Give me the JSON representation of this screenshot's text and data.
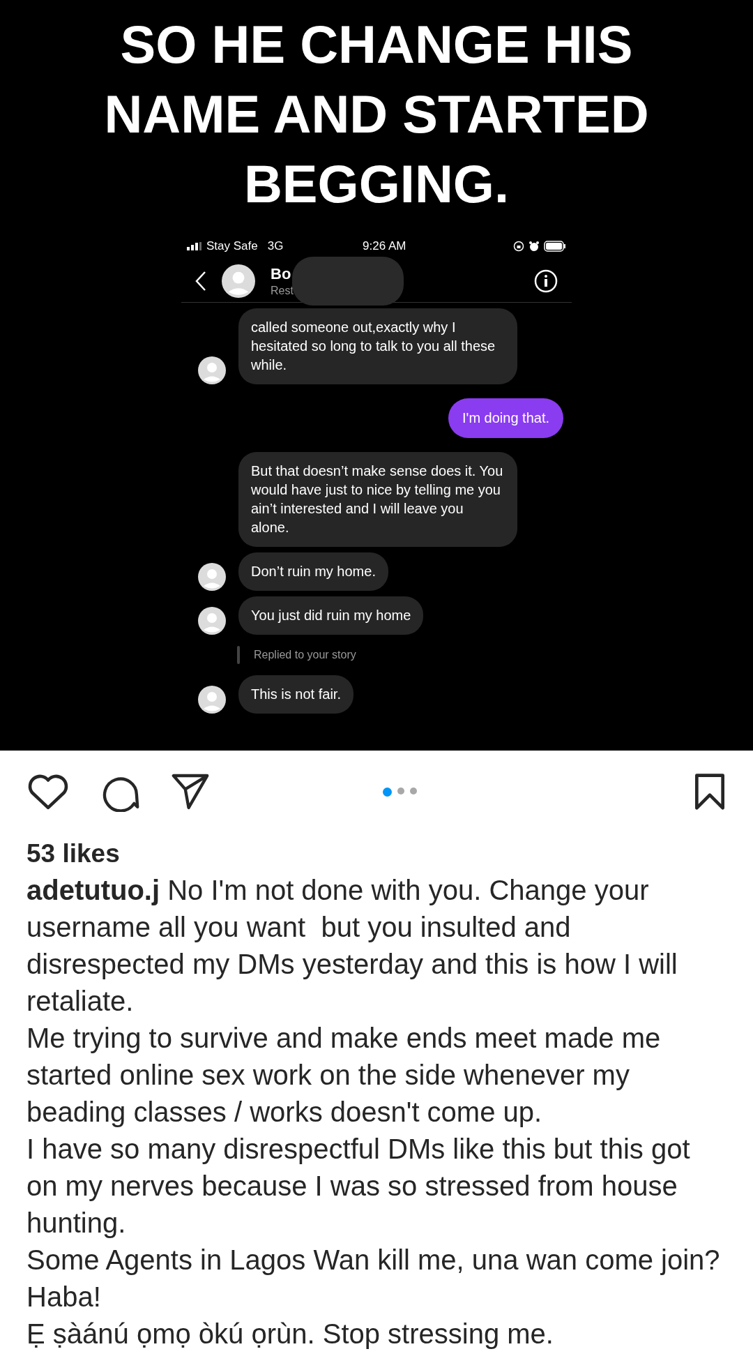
{
  "headline": "SO HE CHANGE HIS NAME AND STARTED BEGGING.",
  "chat_screenshot": {
    "status_bar": {
      "carrier": "Stay Safe",
      "network": "3G",
      "time": "9:26 AM"
    },
    "header": {
      "name": "Bo",
      "subtitle": "Rest"
    },
    "messages": [
      {
        "kind": "incoming",
        "text": "called someone out,exactly why I hesitated so long to talk to you all these while.",
        "avatar": true
      },
      {
        "kind": "outgoing",
        "text": "I'm doing that."
      },
      {
        "kind": "incoming",
        "text": "But that doesn’t make sense does it. You would have just to nice by telling me you ain’t interested and I will leave you alone.",
        "avatar": false
      },
      {
        "kind": "incoming",
        "text": "Don’t ruin my home.",
        "avatar": true
      },
      {
        "kind": "incoming",
        "text": "You just did ruin my home",
        "avatar": true
      },
      {
        "kind": "note",
        "text": "Replied to your story"
      },
      {
        "kind": "incoming",
        "text": "This is not fair.",
        "avatar": true
      }
    ]
  },
  "carousel_dots": [
    {
      "selected": true
    },
    {
      "selected": false
    },
    {
      "selected": false
    }
  ],
  "likes": "53 likes",
  "caption": [
    "**adetutuo.j** No I'm not done with you. Change your username all you want  but you insulted and disrespected my DMs yesterday and this is how I will retaliate.",
    "Me trying to survive and make ends meet made me started online sex work on the side whenever my beading classes / works doesn't come up.",
    "I have so many disrespectful DMs like this but this got on my nerves because I was so stressed from house hunting.",
    "Some Agents in Lagos Wan kill me, una wan come join?",
    "Haba!",
    "Ẹ ṣàánú ọmọ òkú ọrùn. Stop stressing me."
  ]
}
